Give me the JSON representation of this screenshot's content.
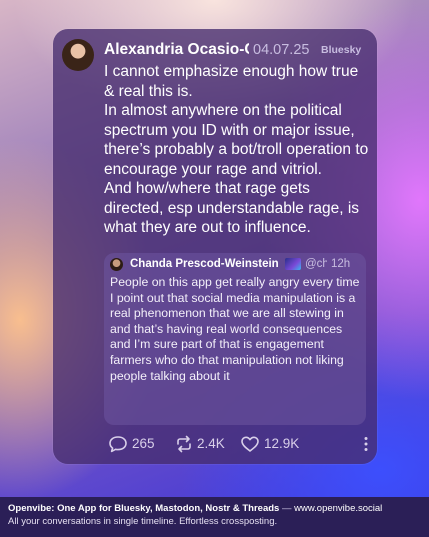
{
  "post": {
    "author": "Alexandria Ocasio-Cortez",
    "date": "04.07.25",
    "platform": "Bluesky",
    "paragraphs": [
      "I cannot emphasize enough how true & real this is.",
      "In almost anywhere on the political spectrum you ID with or major issue, there’s probably a bot/troll operation to encourage your rage and vitriol.",
      "And how/where that rage gets directed, esp understandable rage, is what they are out to influence."
    ],
    "quote": {
      "author": "Chanda Prescod-Weinstein",
      "emoji_icon": "galaxy-emoji",
      "handle": "@ch",
      "time": "12h",
      "text": "People on this app get really angry every time I point out that social media manipulation is a real phenomenon that we are all stewing in and that’s having real world consequences and I’m sure part of that is engagement farmers who do that manipulation not liking people talking about it"
    },
    "actions": {
      "replies": "265",
      "reposts": "2.4K",
      "likes": "12.9K"
    }
  },
  "footer": {
    "brand": "Openvibe: One App for Bluesky, Mastodon, Nostr & Threads",
    "dash": " — ",
    "url": "www.openvibe.social",
    "tagline": "All your conversations in single timeline. Effortless crossposting."
  }
}
